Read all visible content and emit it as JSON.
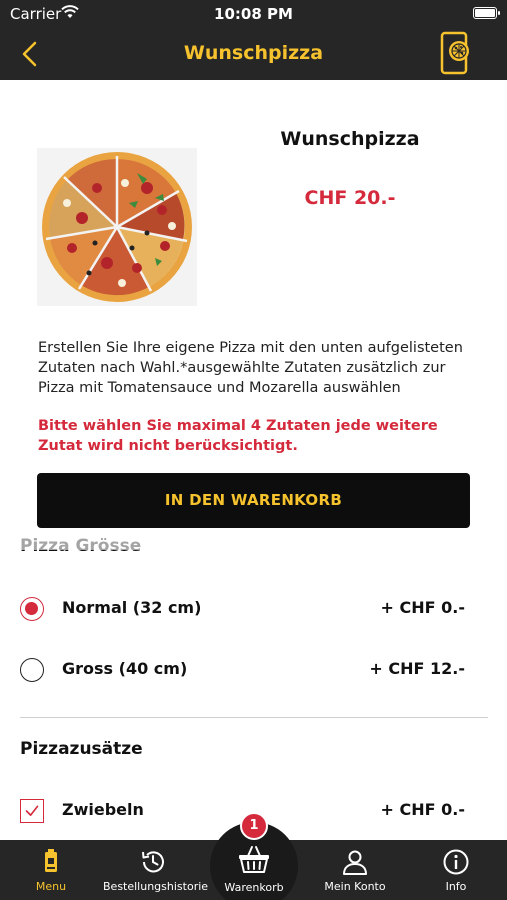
{
  "status": {
    "carrier": "Carrier",
    "time": "10:08 PM"
  },
  "nav": {
    "title": "Wunschpizza",
    "back_icon": "chevron-left-icon",
    "action_icon": "phone-pizza-icon",
    "accent": "#f6c22d"
  },
  "product": {
    "name": "Wunschpizza",
    "price": "CHF 20.-",
    "description": "Erstellen Sie Ihre eigene Pizza mit den unten aufgelisteten Zutaten nach Wahl.*ausgewählte Zutaten zusätzlich zur Pizza mit Tomatensauce und Mozarella auswählen",
    "warning": "Bitte wählen Sie maximal 4 Zutaten jede weitere Zutat wird nicht berücksichtigt."
  },
  "cart_button": {
    "label": "IN DEN WARENKORB"
  },
  "size_section": {
    "title": "Pizza Grösse",
    "options": [
      {
        "label": "Normal (32 cm)",
        "price": "+ CHF 0.-",
        "selected": true
      },
      {
        "label": "Gross (40 cm)",
        "price": "+ CHF 12.-",
        "selected": false
      }
    ]
  },
  "extras_section": {
    "title": "Pizzazusätze",
    "items": [
      {
        "label": "Zwiebeln",
        "price": "+ CHF 0.-",
        "checked": true
      }
    ]
  },
  "tabbar": {
    "items": [
      {
        "label": "Menu",
        "icon": "menu-icon",
        "active": true
      },
      {
        "label": "Bestellungshistorie",
        "icon": "history-icon",
        "active": false
      },
      {
        "label": "Warenkorb",
        "icon": "basket-icon",
        "active": false
      },
      {
        "label": "Mein Konto",
        "icon": "user-icon",
        "active": false
      },
      {
        "label": "Info",
        "icon": "info-icon",
        "active": false
      }
    ],
    "cart_count": "1"
  },
  "colors": {
    "accent_red": "#d42a3c",
    "bar_dark": "#262626",
    "accent_yellow": "#f6c22d"
  }
}
